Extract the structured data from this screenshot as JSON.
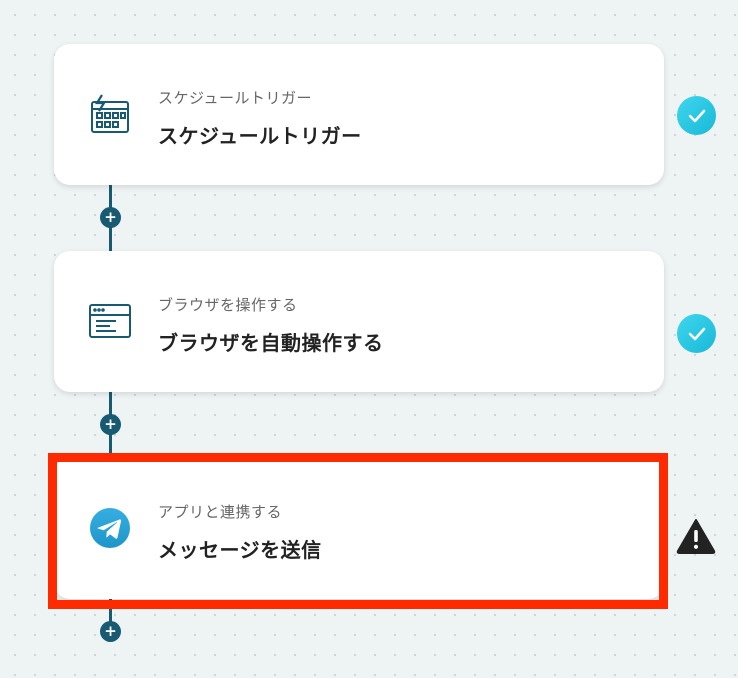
{
  "steps": [
    {
      "subtitle": "スケジュールトリガー",
      "title": "スケジュールトリガー",
      "icon": "calendar-trigger-icon",
      "status": "complete"
    },
    {
      "subtitle": "ブラウザを操作する",
      "title": "ブラウザを自動操作する",
      "icon": "browser-window-icon",
      "status": "complete"
    },
    {
      "subtitle": "アプリと連携する",
      "title": "メッセージを送信",
      "icon": "telegram-icon",
      "status": "warning"
    }
  ],
  "add_step_label": "+",
  "colors": {
    "connector": "#175a72",
    "check": "#22c3df",
    "highlight": "#ff2a00",
    "telegram": "#2aa3df"
  }
}
